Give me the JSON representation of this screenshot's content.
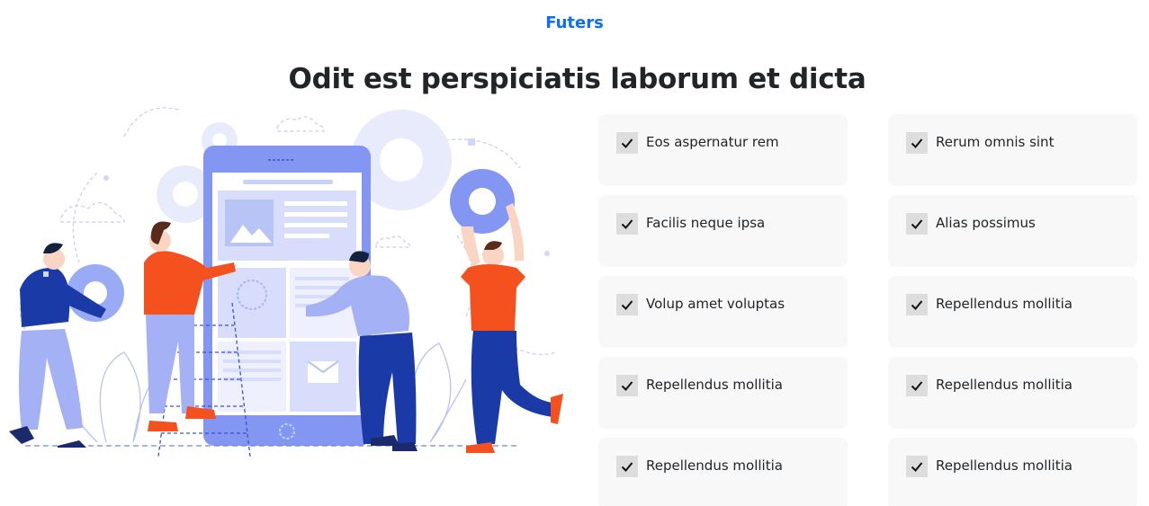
{
  "section": {
    "eyebrow": "Futers",
    "title": "Odit est perspiciatis laborum et dicta"
  },
  "colors": {
    "accent": "#0d6efd",
    "card_bg": "#f8f8f8",
    "check_bg": "#dddddd",
    "illustration_blue": "#8b9cf7",
    "illustration_dark_blue": "#1a3aa8",
    "illustration_orange": "#f4511e"
  },
  "features": [
    {
      "label": "Eos aspernatur rem",
      "icon": "check-icon"
    },
    {
      "label": "Rerum omnis sint",
      "icon": "check-icon"
    },
    {
      "label": "Facilis neque ipsa",
      "icon": "check-icon"
    },
    {
      "label": "Alias possimus",
      "icon": "check-icon"
    },
    {
      "label": "Volup amet voluptas",
      "icon": "check-icon"
    },
    {
      "label": "Repellendus mollitia",
      "icon": "check-icon"
    },
    {
      "label": "Repellendus mollitia",
      "icon": "check-icon"
    },
    {
      "label": "Repellendus mollitia",
      "icon": "check-icon"
    },
    {
      "label": "Repellendus mollitia",
      "icon": "check-icon"
    },
    {
      "label": "Repellendus mollitia",
      "icon": "check-icon"
    }
  ]
}
